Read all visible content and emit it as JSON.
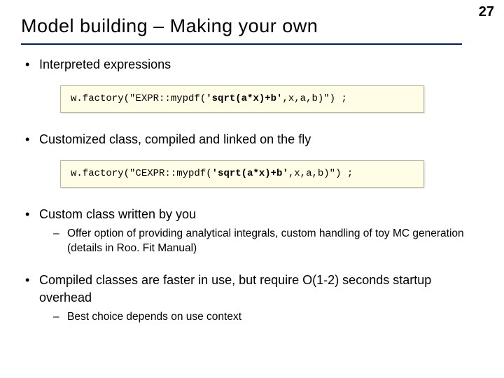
{
  "page_number": "27",
  "title": "Model building – Making your own",
  "bullets": {
    "b1": {
      "text": "Interpreted expressions"
    },
    "b2": {
      "text": "Customized class, compiled and linked on the fly"
    },
    "b3": {
      "text": "Custom class written by you",
      "sub": "Offer option of providing analytical integrals, custom handling of toy MC generation (details in Roo. Fit Manual)"
    },
    "b4": {
      "text": "Compiled classes are faster in use, but require O(1-2) seconds startup overhead",
      "sub": "Best choice depends on use context"
    }
  },
  "code1": {
    "pre": "w.factory(\"EXPR::mypdf(",
    "quoted": "'sqrt(a*x)+b'",
    "post": ",x,a,b)\") ;"
  },
  "code2": {
    "pre": "w.factory(\"CEXPR::mypdf(",
    "quoted": "'sqrt(a*x)+b'",
    "post": ",x,a,b)\") ;"
  }
}
